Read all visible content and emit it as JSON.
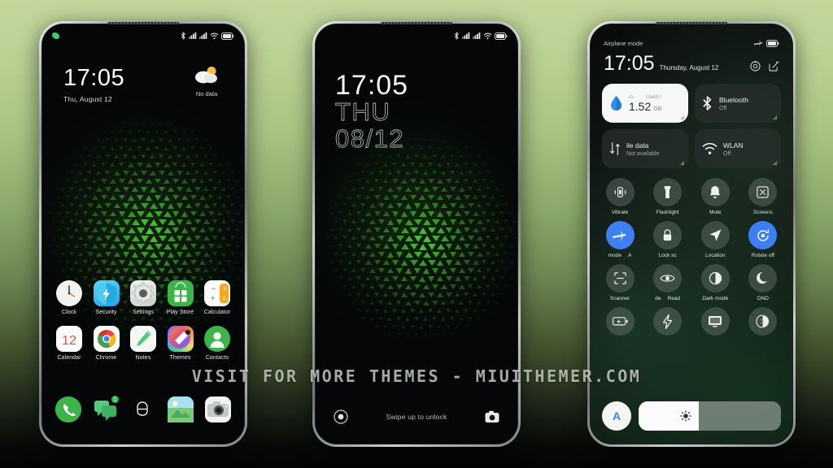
{
  "background": {
    "top_color": "#c3d79b",
    "bottom_color": "#040404"
  },
  "watermark": {
    "text": "VISIT FOR MORE THEMES - MIUITHEMER.COM"
  },
  "phone1": {
    "name": "home-screen",
    "statusbar": {
      "left_icon": "leaf-notification-icon",
      "icons": [
        "bluetooth-icon",
        "signal-icon",
        "signal-icon",
        "wifi-icon",
        "battery-icon"
      ]
    },
    "clock": {
      "time": "17:05",
      "date": "Thu, August 12"
    },
    "weather": {
      "icon": "partly-cloudy-icon",
      "label": "No data"
    },
    "apps_row1": [
      {
        "label": "Clock",
        "icon": "clock-icon"
      },
      {
        "label": "Security",
        "icon": "shield-icon"
      },
      {
        "label": "Settings",
        "icon": "gear-icon"
      },
      {
        "label": "Play Store",
        "icon": "play-store-icon"
      },
      {
        "label": "Calculator",
        "icon": "calculator-icon"
      }
    ],
    "apps_row2": [
      {
        "label": "Calendar",
        "icon": "calendar-icon",
        "day": "12"
      },
      {
        "label": "Chrome",
        "icon": "chrome-icon"
      },
      {
        "label": "Notes",
        "icon": "notes-icon"
      },
      {
        "label": "Themes",
        "icon": "themes-icon"
      },
      {
        "label": "Contacts",
        "icon": "contacts-icon"
      }
    ],
    "dock": [
      {
        "name": "phone-icon"
      },
      {
        "name": "messages-icon",
        "badge": "1"
      },
      {
        "name": "app-drawer-icon"
      },
      {
        "name": "gallery-icon"
      },
      {
        "name": "camera-icon"
      }
    ]
  },
  "phone2": {
    "name": "lock-screen",
    "statusbar": {
      "icons": [
        "bluetooth-icon",
        "signal-icon",
        "signal-icon",
        "wifi-icon",
        "battery-icon"
      ]
    },
    "clock": {
      "time": "17:05",
      "day_of_week": "THU",
      "date": "08/12"
    },
    "bottom": {
      "left_icon": "record-circle-icon",
      "hint": "Swipe up to unlock",
      "right_icon": "camera-icon"
    }
  },
  "phone3": {
    "name": "control-center",
    "statusbar": {
      "status_text": "Airplane mode",
      "icons": [
        "airplane-icon",
        "battery-icon"
      ]
    },
    "header": {
      "time": "17:05",
      "date": "Thursday, August 12",
      "actions": [
        "settings-gear-icon",
        "edit-icon"
      ]
    },
    "big_tiles": [
      {
        "name": "data-usage-tile",
        "icon": "water-drop-icon",
        "header_left": "in",
        "header_right": "Used t",
        "value": "1.52",
        "unit": "GB",
        "style": "light"
      },
      {
        "name": "bluetooth-tile",
        "icon": "bluetooth-icon",
        "title": "Bluetooth",
        "subtitle": "Off",
        "style": "dark"
      },
      {
        "name": "mobile-data-tile",
        "icon": "data-transfer-icon",
        "title": "ile data",
        "subtitle": "Not available",
        "style": "dark"
      },
      {
        "name": "wlan-tile",
        "icon": "wifi-icon",
        "title": "WLAN",
        "subtitle": "Off",
        "style": "dark"
      }
    ],
    "toggle_row1": [
      {
        "label": "Vibrate",
        "icon": "vibrate-icon",
        "on": false
      },
      {
        "label": "Flashlight",
        "icon": "flashlight-icon",
        "on": false
      },
      {
        "label": "Mute",
        "icon": "bell-icon",
        "on": false
      },
      {
        "label": "Screens",
        "icon": "screenshot-icon",
        "on": false
      }
    ],
    "toggle_row2": [
      {
        "label": "mode",
        "label_extra": "A",
        "icon": "airplane-icon",
        "on": true
      },
      {
        "label": "Lock sc",
        "icon": "lock-icon",
        "on": false
      },
      {
        "label": "Location",
        "icon": "location-icon",
        "on": false
      },
      {
        "label": "Rotate off",
        "icon": "rotate-icon",
        "on": true
      }
    ],
    "toggle_row3": [
      {
        "label": "Scanner",
        "icon": "scanner-icon",
        "on": false
      },
      {
        "label": "de",
        "label_extra": "Read",
        "icon": "eye-icon",
        "on": false
      },
      {
        "label": "Dark mode",
        "icon": "contrast-icon",
        "on": false
      },
      {
        "label": "DND",
        "icon": "moon-icon",
        "on": false
      }
    ],
    "toggle_row4": [
      {
        "label": "",
        "icon": "battery-saver-icon",
        "on": false
      },
      {
        "label": "",
        "icon": "lightning-icon",
        "on": false
      },
      {
        "label": "",
        "icon": "cast-icon",
        "on": false
      },
      {
        "label": "",
        "icon": "tag-icon",
        "on": false
      }
    ],
    "brightness": {
      "auto_label": "A",
      "icon": "sun-icon",
      "fill_percent": 42
    }
  }
}
